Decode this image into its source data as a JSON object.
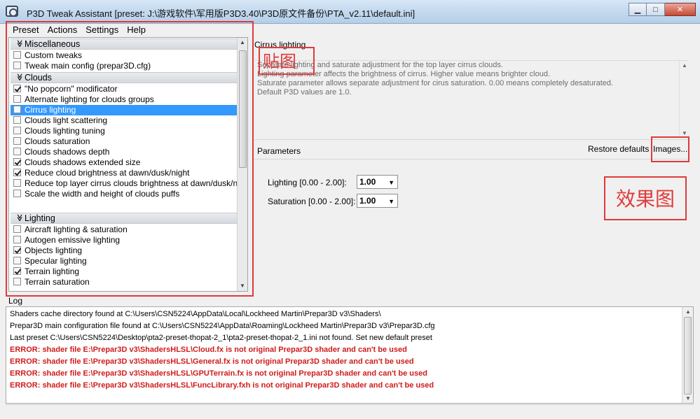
{
  "window": {
    "title": "P3D Tweak Assistant [preset: J:\\游戏软件\\军用版P3D3.40\\P3D原文件备份\\PTA_v2.11\\default.ini]",
    "buttons": {
      "minimize": "▁",
      "maximize": "□",
      "close": "✕"
    }
  },
  "menu": [
    "Preset",
    "Actions",
    "Settings",
    "Help"
  ],
  "tweaks": {
    "groups": [
      {
        "name": "Miscellaneous",
        "items": [
          {
            "label": "Custom tweaks",
            "checked": false
          },
          {
            "label": "Tweak main config (prepar3D.cfg)",
            "checked": false
          }
        ]
      },
      {
        "name": "Clouds",
        "items": [
          {
            "label": "\"No popcorn\" modificator",
            "checked": true
          },
          {
            "label": "Alternate lighting for clouds groups",
            "checked": false
          },
          {
            "label": "Cirrus lighting",
            "checked": false,
            "selected": true
          },
          {
            "label": "Clouds light scattering",
            "checked": false
          },
          {
            "label": "Clouds lighting tuning",
            "checked": false
          },
          {
            "label": "Clouds saturation",
            "checked": false
          },
          {
            "label": "Clouds shadows depth",
            "checked": false
          },
          {
            "label": "Clouds shadows extended size",
            "checked": true
          },
          {
            "label": "Reduce cloud brightness at dawn/dusk/night",
            "checked": true
          },
          {
            "label": "Reduce top layer cirrus clouds brightness at dawn/dusk/ni",
            "checked": false
          },
          {
            "label": "Scale the width and height of clouds puffs",
            "checked": false
          }
        ]
      },
      {
        "name": "Lighting",
        "items": [
          {
            "label": "Aircraft lighting & saturation",
            "checked": false
          },
          {
            "label": "Autogen emissive lighting",
            "checked": false
          },
          {
            "label": "Objects lighting",
            "checked": true
          },
          {
            "label": "Specular lighting",
            "checked": false
          },
          {
            "label": "Terrain lighting",
            "checked": true
          },
          {
            "label": "Terrain saturation",
            "checked": false
          }
        ]
      }
    ]
  },
  "detail": {
    "title": "Cirrus lighting",
    "description": [
      "Separate lighting and saturate adjustment for the top layer cirrus clouds.",
      "Lighting parameter affects the brightness of cirrus. Higher value means brighter cloud.",
      "Saturate parameter allows separate adjustment for cirus saturation. 0.00 means completely desaturated.",
      "Default P3D values are 1.0."
    ],
    "parameters_label": "Parameters",
    "restore_label": "Restore defaults",
    "images_label": "Images...",
    "params": [
      {
        "label": "Lighting [0.00 - 2.00]:",
        "value": "1.00"
      },
      {
        "label": "Saturation [0.00 - 2.00]:",
        "value": "1.00"
      }
    ]
  },
  "annotations": {
    "stamp_image": "贴图",
    "stamp_effect": "效果图"
  },
  "log": {
    "label": "Log",
    "lines": [
      {
        "text": "Shaders cache directory found at C:\\Users\\CSN5224\\AppData\\Local\\Lockheed Martin\\Prepar3D v3\\Shaders\\",
        "error": false
      },
      {
        "text": "Prepar3D main configuration file found at C:\\Users\\CSN5224\\AppData\\Roaming\\Lockheed Martin\\Prepar3D v3\\Prepar3D.cfg",
        "error": false
      },
      {
        "text": "Last preset C:\\Users\\CSN5224\\Desktop\\pta2-preset-thopat-2_1\\pta2-preset-thopat-2_1.ini not found. Set new default preset",
        "error": false
      },
      {
        "text": "ERROR: shader file E:\\Prepar3D v3\\ShadersHLSL\\Cloud.fx is not original Prepar3D shader and can't be used",
        "error": true
      },
      {
        "text": "ERROR: shader file E:\\Prepar3D v3\\ShadersHLSL\\General.fx is not original Prepar3D shader and can't be used",
        "error": true
      },
      {
        "text": "ERROR: shader file E:\\Prepar3D v3\\ShadersHLSL\\GPUTerrain.fx is not original Prepar3D shader and can't be used",
        "error": true
      },
      {
        "text": "ERROR: shader file E:\\Prepar3D v3\\ShadersHLSL\\FuncLibrary.fxh is not original Prepar3D shader and can't be used",
        "error": true
      }
    ]
  },
  "colors": {
    "selection": "#3399ff",
    "error_text": "#d01b1b",
    "annotation_red": "#e03a3a"
  }
}
